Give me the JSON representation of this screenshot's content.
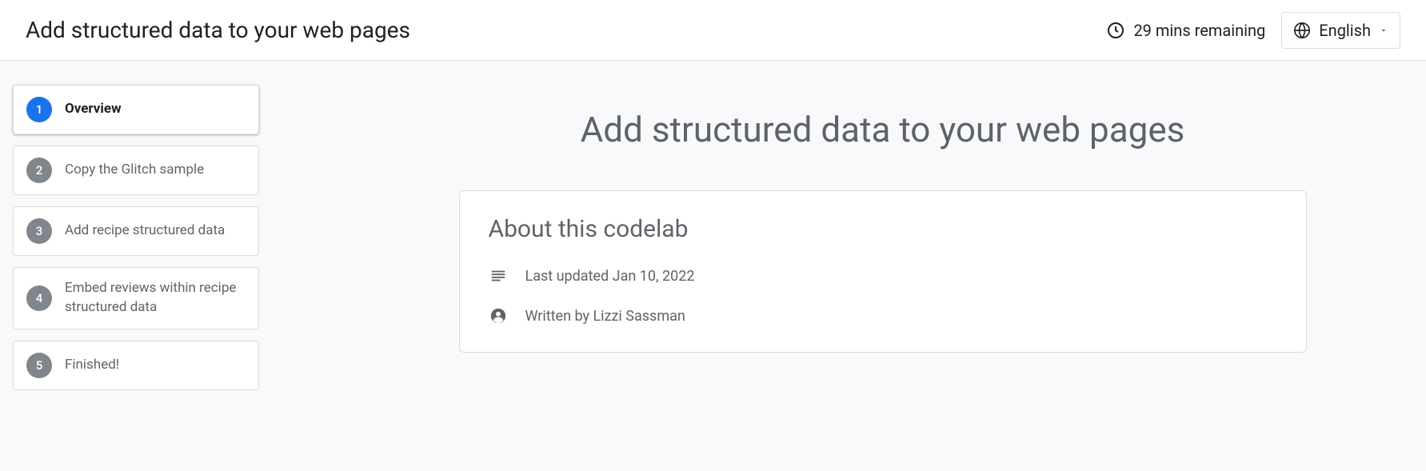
{
  "header": {
    "title": "Add structured data to your web pages",
    "time_remaining": "29 mins remaining",
    "language": "English"
  },
  "steps": [
    {
      "num": "1",
      "label": "Overview",
      "active": true
    },
    {
      "num": "2",
      "label": "Copy the Glitch sample",
      "active": false
    },
    {
      "num": "3",
      "label": "Add recipe structured data",
      "active": false
    },
    {
      "num": "4",
      "label": "Embed reviews within recipe structured data",
      "active": false
    },
    {
      "num": "5",
      "label": "Finished!",
      "active": false
    }
  ],
  "main": {
    "title": "Add structured data to your web pages",
    "about_heading": "About this codelab",
    "last_updated": "Last updated Jan 10, 2022",
    "author": "Written by Lizzi Sassman"
  }
}
